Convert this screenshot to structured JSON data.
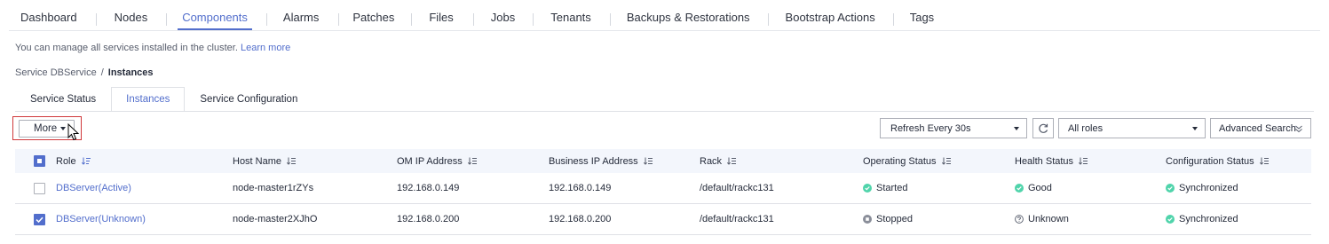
{
  "nav": {
    "items": [
      "Dashboard",
      "Nodes",
      "Components",
      "Alarms",
      "Patches",
      "Files",
      "Jobs",
      "Tenants",
      "Backups & Restorations",
      "Bootstrap Actions",
      "Tags"
    ],
    "active": "Components"
  },
  "info": {
    "text": "You can manage all services installed in the cluster.",
    "link": "Learn more"
  },
  "breadcrumb": {
    "parent": "Service DBService",
    "separator": "/",
    "current": "Instances"
  },
  "subtabs": {
    "items": [
      "Service Status",
      "Instances",
      "Service Configuration"
    ],
    "active": "Instances"
  },
  "toolbar": {
    "more_label": "More",
    "refresh_value": "Refresh Every 30s",
    "roles_value": "All roles",
    "advanced_search_label": "Advanced Search"
  },
  "table": {
    "columns": [
      "Role",
      "Host Name",
      "OM IP Address",
      "Business IP Address",
      "Rack",
      "Operating Status",
      "Health Status",
      "Configuration Status"
    ],
    "rows": [
      {
        "selected": false,
        "role": "DBServer(Active)",
        "host": "node-master1rZYs",
        "om_ip": "192.168.0.149",
        "business_ip": "192.168.0.149",
        "rack": "/default/rackc131",
        "operating": "Started",
        "operating_icon": "check-circle-icon",
        "health": "Good",
        "health_icon": "check-circle-icon",
        "config": "Synchronized",
        "config_icon": "check-circle-icon"
      },
      {
        "selected": true,
        "role": "DBServer(Unknown)",
        "host": "node-master2XJhO",
        "om_ip": "192.168.0.200",
        "business_ip": "192.168.0.200",
        "rack": "/default/rackc131",
        "operating": "Stopped",
        "operating_icon": "stop-circle-icon",
        "health": "Unknown",
        "health_icon": "question-circle-icon",
        "config": "Synchronized",
        "config_icon": "check-circle-icon"
      }
    ]
  },
  "colors": {
    "accent": "#526ecc",
    "success": "#50d4ab",
    "neutral": "#8a8e99",
    "highlight": "#d0383b"
  }
}
